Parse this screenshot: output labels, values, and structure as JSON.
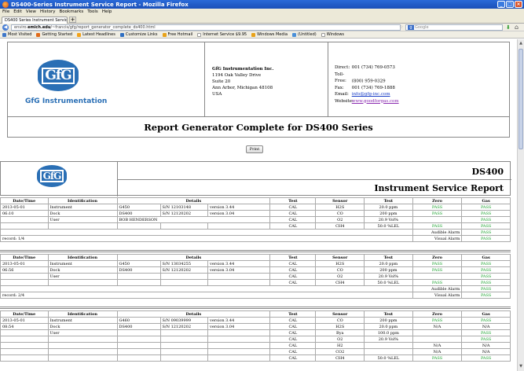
{
  "browser": {
    "title": "DS400-Series Instrument Service Report - Mozilla Firefox",
    "menu": [
      "File",
      "Edit",
      "View",
      "History",
      "Bookmarks",
      "Tools",
      "Help"
    ],
    "tab_label": "DS400 Series Instrument Service Report",
    "url_prefix": "enviro.",
    "url_host": "emich.edu",
    "url_path": "/~francis/gfg/report_generator_complete_ds400.html",
    "search_placeholder": "Google",
    "bookmarks": [
      "Most Visited",
      "Getting Started",
      "Latest Headlines",
      "Customize Links",
      "Free Hotmail",
      "Internet Service $9.95",
      "Windows Media",
      "(Untitled)",
      "Windows"
    ]
  },
  "header": {
    "logo_text": "GfG",
    "logo_caption": "GfG Instrumentation",
    "company": "GfG Instrumentation Inc.",
    "address": [
      "1194 Oak Valley Drive",
      "Suite 20",
      "Ann Arbor, Michigan 48108",
      "USA"
    ],
    "contact": [
      {
        "label": "Direct:",
        "value": "001 (734) 769-0573"
      },
      {
        "label": "Toll-Free:",
        "value": "(800) 959-0329"
      },
      {
        "label": "Fax:",
        "value": "001 (734) 769-1888"
      }
    ],
    "email_label": "Email:",
    "email": "info@gfg-inc.com",
    "website_label": "Website:",
    "website": "www.goodforgas.com",
    "title": "Report Generator Complete for DS400 Series"
  },
  "print_label": "Print",
  "report": {
    "model": "DS400",
    "title": "Instrument Service Report"
  },
  "columns": [
    "Date/Time",
    "Identification",
    "Details",
    "Test",
    "Sensor",
    "Test",
    "Zero",
    "Gas"
  ],
  "records": [
    {
      "date": "2013-05-01",
      "time": "06:10",
      "rows": [
        {
          "id": "Instrument",
          "model": "G450",
          "serial": "S/N 12103148",
          "version": "version 3.44",
          "test": "CAL",
          "sensor": "H2S",
          "value": "20.0 ppm",
          "zero": "PASS",
          "gas": "PASS"
        },
        {
          "id": "Dock",
          "model": "DS400",
          "serial": "S/N 12120202",
          "version": "version 3.04",
          "test": "CAL",
          "sensor": "CO",
          "value": "200 ppm",
          "zero": "PASS",
          "gas": "PASS"
        },
        {
          "id": "User",
          "user": "BOB HENDERSON",
          "test": "CAL",
          "sensor": "O2",
          "value": "20.9 Vol%",
          "zero": "",
          "gas": "PASS"
        },
        {
          "test": "CAL",
          "sensor": "CH4",
          "value": "50.0 %LEL",
          "zero": "PASS",
          "gas": "PASS"
        }
      ],
      "alarms": [
        {
          "label": "Audible Alarm",
          "result": "PASS"
        },
        {
          "label": "Visual Alarm",
          "result": "PASS"
        }
      ],
      "record_label": "record: 1/4"
    },
    {
      "date": "2013-05-01",
      "time": "06:56",
      "rows": [
        {
          "id": "Instrument",
          "model": "G450",
          "serial": "S/N 13034255",
          "version": "version 3.44",
          "test": "CAL",
          "sensor": "H2S",
          "value": "20.0 ppm",
          "zero": "PASS",
          "gas": "PASS"
        },
        {
          "id": "Dock",
          "model": "DS400",
          "serial": "S/N 12120202",
          "version": "version 3.04",
          "test": "CAL",
          "sensor": "CO",
          "value": "200 ppm",
          "zero": "PASS",
          "gas": "PASS"
        },
        {
          "id": "User",
          "test": "CAL",
          "sensor": "O2",
          "value": "20.9 Vol%",
          "zero": "",
          "gas": "PASS"
        },
        {
          "test": "CAL",
          "sensor": "CH4",
          "value": "50.0 %LEL",
          "zero": "PASS",
          "gas": "PASS"
        }
      ],
      "alarms": [
        {
          "label": "Audible Alarm",
          "result": "PASS"
        },
        {
          "label": "Visual Alarm",
          "result": "PASS"
        }
      ],
      "record_label": "record: 2/4"
    },
    {
      "date": "2013-05-01",
      "time": "08:54",
      "rows": [
        {
          "id": "Instrument",
          "model": "G460",
          "serial": "S/N 09039999",
          "version": "version 3.44",
          "test": "CAL",
          "sensor": "CO",
          "value": "200 ppm",
          "zero": "PASS",
          "gas": "PASS"
        },
        {
          "id": "Dock",
          "model": "DS400",
          "serial": "S/N 12120202",
          "version": "version 3.04",
          "test": "CAL",
          "sensor": "H2S",
          "value": "20.0 ppm",
          "zero": "N/A",
          "gas": "N/A"
        },
        {
          "id": "User",
          "test": "CAL",
          "sensor": "Bya",
          "value": "100.0 ppm",
          "zero": "",
          "gas": "PASS"
        },
        {
          "test": "CAL",
          "sensor": "O2",
          "value": "20.9 Vol%",
          "zero": "",
          "gas": "PASS"
        },
        {
          "test": "CAL",
          "sensor": "H2",
          "value": "",
          "zero": "N/A",
          "gas": "N/A"
        },
        {
          "test": "CAL",
          "sensor": "CO2",
          "value": "",
          "zero": "N/A",
          "gas": "N/A"
        },
        {
          "test": "CAL",
          "sensor": "CH4",
          "value": "50.0 %LEL",
          "zero": "PASS",
          "gas": "PASS"
        }
      ]
    }
  ]
}
